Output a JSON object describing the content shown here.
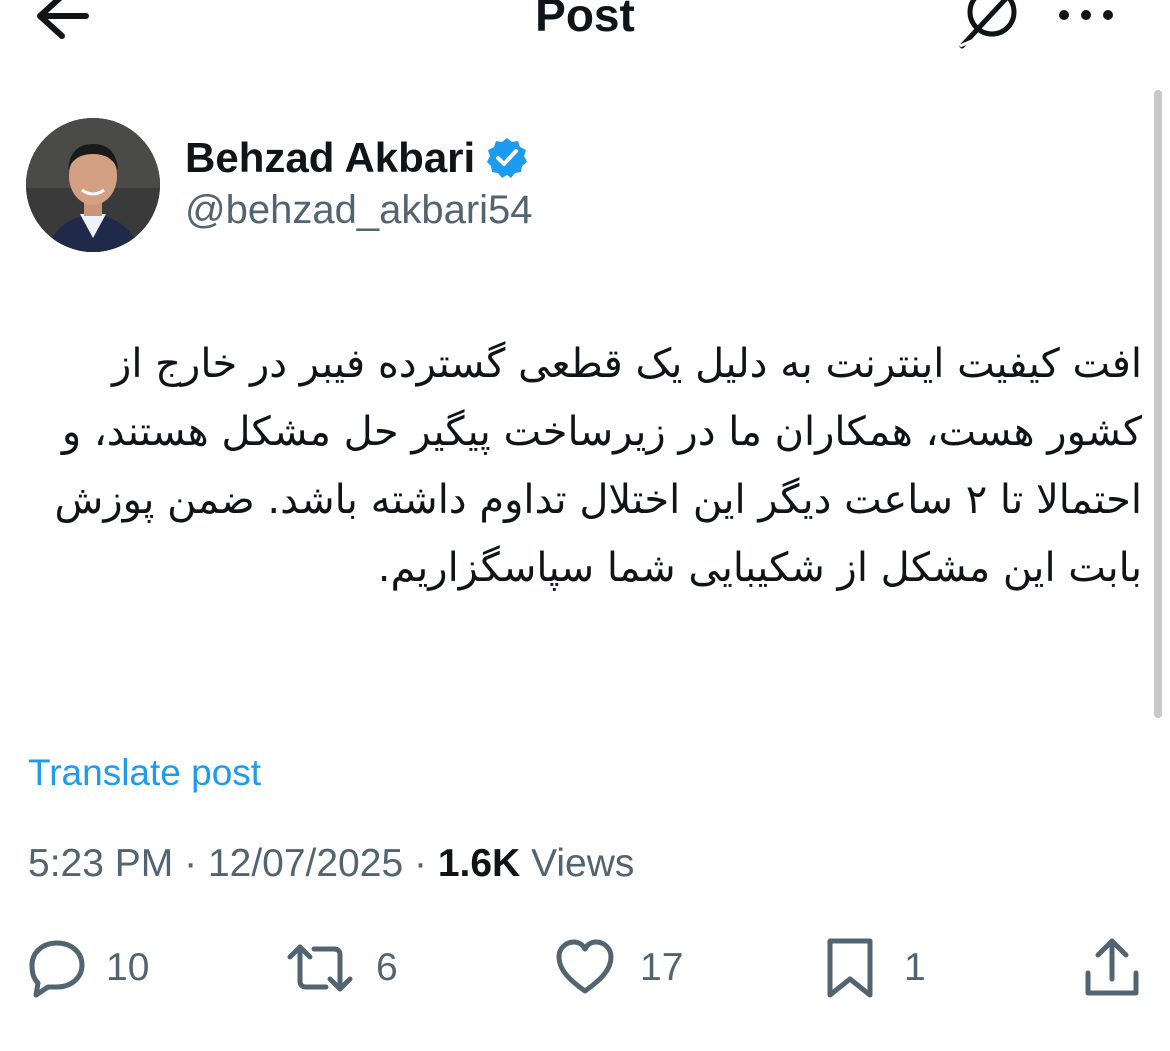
{
  "header": {
    "title": "Post",
    "back_icon": "arrow-left-icon",
    "grok_icon": "grok-icon",
    "more_icon": "more-horizontal-icon"
  },
  "author": {
    "display_name": "Behzad Akbari",
    "handle": "@behzad_akbari54",
    "verified": true,
    "verified_color": "#1d9bf0"
  },
  "post": {
    "text": "افت کیفیت اینترنت به دلیل یک قطعی گسترده فیبر در خارج از کشور هست، همکاران ما در زیرساخت پیگیر حل مشکل هستند، و احتمالا تا ۲ ساعت دیگر این اختلال تداوم داشته باشد. ضمن پوزش بابت این مشکل از شکیبایی شما سپاسگزاریم.",
    "translate_label": "Translate post",
    "time": "5:23 PM",
    "separator": "·",
    "date": "12/07/2025",
    "views_count": "1.6K",
    "views_label": "Views"
  },
  "actions": {
    "replies": "10",
    "reposts": "6",
    "likes": "17",
    "bookmarks": "1",
    "reply_icon": "reply-icon",
    "repost_icon": "repost-icon",
    "like_icon": "heart-icon",
    "bookmark_icon": "bookmark-icon",
    "share_icon": "share-icon"
  },
  "colors": {
    "text_primary": "#0f1419",
    "text_secondary": "#536471",
    "link": "#1d9bf0"
  }
}
